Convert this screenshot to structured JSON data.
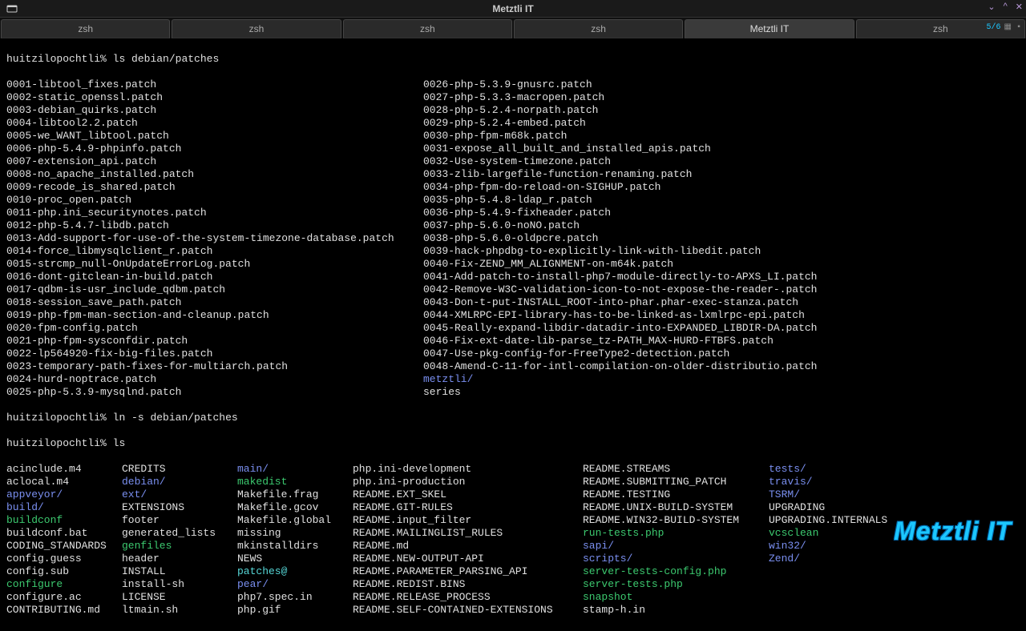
{
  "window": {
    "title": "Metztli IT",
    "controls": {
      "min": "⌄",
      "max": "^",
      "close": "✕"
    },
    "tab_counter": "5/6",
    "tab_counter_icons": "▦ ▪"
  },
  "tabs": [
    {
      "label": "zsh",
      "active": false
    },
    {
      "label": "zsh",
      "active": false
    },
    {
      "label": "zsh",
      "active": false
    },
    {
      "label": "zsh",
      "active": false
    },
    {
      "label": "Metztli IT",
      "active": true
    },
    {
      "label": "zsh",
      "active": false
    }
  ],
  "prompts": {
    "user": "huitzilopochtli%",
    "cmd1": "ls debian/patches",
    "cmd2": "ln -s debian/patches",
    "cmd3": "ls"
  },
  "patches_left": [
    "0001-libtool_fixes.patch",
    "0002-static_openssl.patch",
    "0003-debian_quirks.patch",
    "0004-libtool2.2.patch",
    "0005-we_WANT_libtool.patch",
    "0006-php-5.4.9-phpinfo.patch",
    "0007-extension_api.patch",
    "0008-no_apache_installed.patch",
    "0009-recode_is_shared.patch",
    "0010-proc_open.patch",
    "0011-php.ini_securitynotes.patch",
    "0012-php-5.4.7-libdb.patch",
    "0013-Add-support-for-use-of-the-system-timezone-database.patch",
    "0014-force_libmysqlclient_r.patch",
    "0015-strcmp_null-OnUpdateErrorLog.patch",
    "0016-dont-gitclean-in-build.patch",
    "0017-qdbm-is-usr_include_qdbm.patch",
    "0018-session_save_path.patch",
    "0019-php-fpm-man-section-and-cleanup.patch",
    "0020-fpm-config.patch",
    "0021-php-fpm-sysconfdir.patch",
    "0022-lp564920-fix-big-files.patch",
    "0023-temporary-path-fixes-for-multiarch.patch",
    "0024-hurd-noptrace.patch",
    "0025-php-5.3.9-mysqlnd.patch"
  ],
  "patches_right": [
    "0026-php-5.3.9-gnusrc.patch",
    "0027-php-5.3.3-macropen.patch",
    "0028-php-5.2.4-norpath.patch",
    "0029-php-5.2.4-embed.patch",
    "0030-php-fpm-m68k.patch",
    "0031-expose_all_built_and_installed_apis.patch",
    "0032-Use-system-timezone.patch",
    "0033-zlib-largefile-function-renaming.patch",
    "0034-php-fpm-do-reload-on-SIGHUP.patch",
    "0035-php-5.4.8-ldap_r.patch",
    "0036-php-5.4.9-fixheader.patch",
    "0037-php-5.6.0-noNO.patch",
    "0038-php-5.6.0-oldpcre.patch",
    "0039-hack-phpdbg-to-explicitly-link-with-libedit.patch",
    "0040-Fix-ZEND_MM_ALIGNMENT-on-m64k.patch",
    "0041-Add-patch-to-install-php7-module-directly-to-APXS_LI.patch",
    "0042-Remove-W3C-validation-icon-to-not-expose-the-reader-.patch",
    "0043-Don-t-put-INSTALL_ROOT-into-phar.phar-exec-stanza.patch",
    "0044-XMLRPC-EPI-library-has-to-be-linked-as-lxmlrpc-epi.patch",
    "0045-Really-expand-libdir-datadir-into-EXPANDED_LIBDIR-DA.patch",
    "0046-Fix-ext-date-lib-parse_tz-PATH_MAX-HURD-FTBFS.patch",
    "0047-Use-pkg-config-for-FreeType2-detection.patch",
    "0048-Amend-C-11-for-intl-compilation-on-older-distributio.patch"
  ],
  "patches_right_extra": [
    {
      "text": "metztli/",
      "cls": "dir"
    },
    {
      "text": "series",
      "cls": ""
    }
  ],
  "ls_columns": [
    [
      {
        "text": "acinclude.m4",
        "cls": ""
      },
      {
        "text": "aclocal.m4",
        "cls": ""
      },
      {
        "text": "appveyor/",
        "cls": "dir"
      },
      {
        "text": "build/",
        "cls": "dir"
      },
      {
        "text": "buildconf",
        "cls": "exe"
      },
      {
        "text": "buildconf.bat",
        "cls": ""
      },
      {
        "text": "CODING_STANDARDS",
        "cls": ""
      },
      {
        "text": "config.guess",
        "cls": ""
      },
      {
        "text": "config.sub",
        "cls": ""
      },
      {
        "text": "configure",
        "cls": "exe"
      },
      {
        "text": "configure.ac",
        "cls": ""
      },
      {
        "text": "CONTRIBUTING.md",
        "cls": ""
      }
    ],
    [
      {
        "text": "CREDITS",
        "cls": ""
      },
      {
        "text": "debian/",
        "cls": "dir"
      },
      {
        "text": "ext/",
        "cls": "dir"
      },
      {
        "text": "EXTENSIONS",
        "cls": ""
      },
      {
        "text": "footer",
        "cls": ""
      },
      {
        "text": "generated_lists",
        "cls": ""
      },
      {
        "text": "genfiles",
        "cls": "exe"
      },
      {
        "text": "header",
        "cls": ""
      },
      {
        "text": "INSTALL",
        "cls": ""
      },
      {
        "text": "install-sh",
        "cls": ""
      },
      {
        "text": "LICENSE",
        "cls": ""
      },
      {
        "text": "ltmain.sh",
        "cls": ""
      }
    ],
    [
      {
        "text": "main/",
        "cls": "dir"
      },
      {
        "text": "makedist",
        "cls": "exe"
      },
      {
        "text": "Makefile.frag",
        "cls": ""
      },
      {
        "text": "Makefile.gcov",
        "cls": ""
      },
      {
        "text": "Makefile.global",
        "cls": ""
      },
      {
        "text": "missing",
        "cls": ""
      },
      {
        "text": "mkinstalldirs",
        "cls": ""
      },
      {
        "text": "NEWS",
        "cls": ""
      },
      {
        "text": "patches@",
        "cls": "link-special"
      },
      {
        "text": "pear/",
        "cls": "dir"
      },
      {
        "text": "php7.spec.in",
        "cls": ""
      },
      {
        "text": "php.gif",
        "cls": ""
      }
    ],
    [
      {
        "text": "php.ini-development",
        "cls": ""
      },
      {
        "text": "php.ini-production",
        "cls": ""
      },
      {
        "text": "README.EXT_SKEL",
        "cls": ""
      },
      {
        "text": "README.GIT-RULES",
        "cls": ""
      },
      {
        "text": "README.input_filter",
        "cls": ""
      },
      {
        "text": "README.MAILINGLIST_RULES",
        "cls": ""
      },
      {
        "text": "README.md",
        "cls": ""
      },
      {
        "text": "README.NEW-OUTPUT-API",
        "cls": ""
      },
      {
        "text": "README.PARAMETER_PARSING_API",
        "cls": ""
      },
      {
        "text": "README.REDIST.BINS",
        "cls": ""
      },
      {
        "text": "README.RELEASE_PROCESS",
        "cls": ""
      },
      {
        "text": "README.SELF-CONTAINED-EXTENSIONS",
        "cls": ""
      }
    ],
    [
      {
        "text": "README.STREAMS",
        "cls": ""
      },
      {
        "text": "README.SUBMITTING_PATCH",
        "cls": ""
      },
      {
        "text": "README.TESTING",
        "cls": ""
      },
      {
        "text": "README.UNIX-BUILD-SYSTEM",
        "cls": ""
      },
      {
        "text": "README.WIN32-BUILD-SYSTEM",
        "cls": ""
      },
      {
        "text": "run-tests.php",
        "cls": "exe"
      },
      {
        "text": "sapi/",
        "cls": "dir"
      },
      {
        "text": "scripts/",
        "cls": "dir"
      },
      {
        "text": "server-tests-config.php",
        "cls": "exe"
      },
      {
        "text": "server-tests.php",
        "cls": "exe"
      },
      {
        "text": "snapshot",
        "cls": "exe"
      },
      {
        "text": "stamp-h.in",
        "cls": ""
      }
    ],
    [
      {
        "text": "tests/",
        "cls": "dir"
      },
      {
        "text": "travis/",
        "cls": "dir"
      },
      {
        "text": "TSRM/",
        "cls": "dir"
      },
      {
        "text": "UPGRADING",
        "cls": ""
      },
      {
        "text": "UPGRADING.INTERNALS",
        "cls": ""
      },
      {
        "text": "vcsclean",
        "cls": "exe"
      },
      {
        "text": "win32/",
        "cls": "dir"
      },
      {
        "text": "Zend/",
        "cls": "dir"
      }
    ]
  ],
  "watermark": "Metztli IT"
}
